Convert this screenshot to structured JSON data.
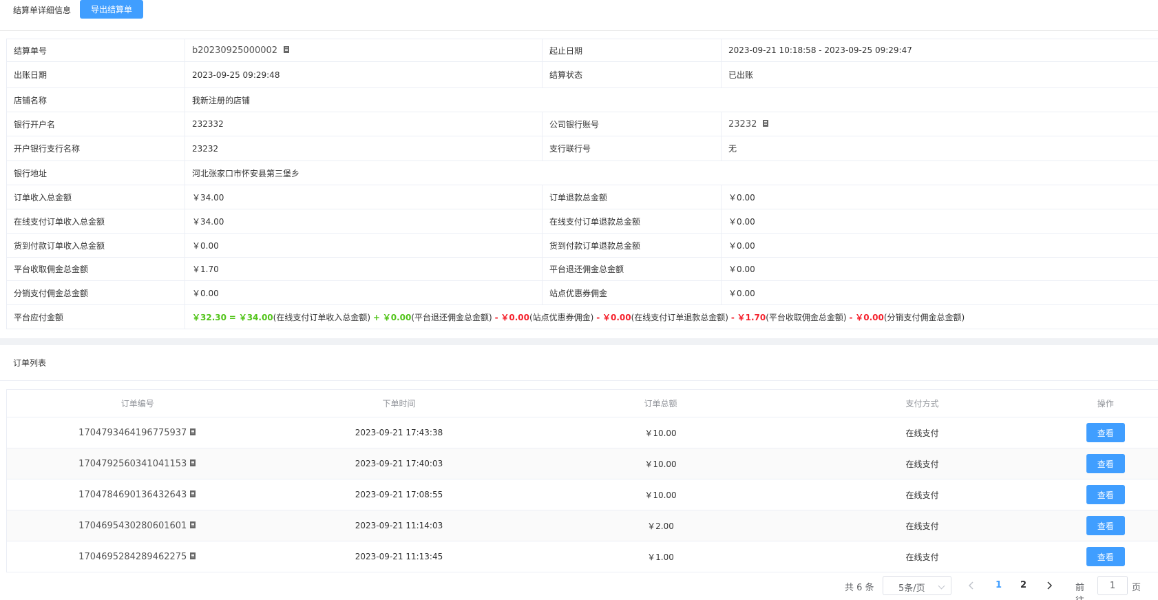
{
  "header": {
    "title": "结算单详细信息",
    "export_label": "导出结算单"
  },
  "info": {
    "bill_no_label": "结算单号",
    "bill_no": "b20230925000002",
    "period_label": "起止日期",
    "period": "2023-09-21 10:18:58 - 2023-09-25 09:29:47",
    "bill_date_label": "出账日期",
    "bill_date": "2023-09-25 09:29:48",
    "status_label": "结算状态",
    "status": "已出账",
    "shop_label": "店铺名称",
    "shop": "我新注册的店铺",
    "bank_account_name_label": "银行开户名",
    "bank_account_name": "232332",
    "company_account_label": "公司银行账号",
    "company_account": "23232",
    "branch_label": "开户银行支行名称",
    "branch": "23232",
    "branch_code_label": "支行联行号",
    "branch_code": "无",
    "bank_address_label": "银行地址",
    "bank_address": "河北张家口市怀安县第三堡乡",
    "order_income_label": "订单收入总金额",
    "order_income": "￥34.00",
    "order_refund_label": "订单退款总金额",
    "order_refund": "￥0.00",
    "online_income_label": "在线支付订单收入总金额",
    "online_income": "￥34.00",
    "online_refund_label": "在线支付订单退款总金额",
    "online_refund": "￥0.00",
    "cod_income_label": "货到付款订单收入总金额",
    "cod_income": "￥0.00",
    "cod_refund_label": "货到付款订单退款总金额",
    "cod_refund": "￥0.00",
    "commission_label": "平台收取佣金总金额",
    "commission": "￥1.70",
    "commission_return_label": "平台退还佣金总金额",
    "commission_return": "￥0.00",
    "distribution_label": "分销支付佣金总金额",
    "distribution": "￥0.00",
    "coupon_label": "站点优惠券佣金",
    "coupon": "￥0.00",
    "payable_label": "平台应付金额",
    "formula": {
      "result": "￥32.30",
      "eq": "=",
      "v1": "￥34.00",
      "t1": "(在线支付订单收入总金额)",
      "op1": "+",
      "v2": "￥0.00",
      "t2": "(平台退还佣金总金额)",
      "op2": "-",
      "v3": "￥0.00",
      "t3": "(站点优惠券佣金)",
      "op3": "-",
      "v4": "￥0.00",
      "t4": "(在线支付订单退款总金额)",
      "op4": "-",
      "v5": "￥1.70",
      "t5": "(平台收取佣金总金额)",
      "op5": "-",
      "v6": "￥0.00",
      "t6": "(分销支付佣金总金额)"
    }
  },
  "orders": {
    "title": "订单列表",
    "columns": [
      "订单编号",
      "下单时间",
      "订单总额",
      "支付方式",
      "操作"
    ],
    "view_label": "查看",
    "rows": [
      {
        "id": "1704793464196775937",
        "time": "2023-09-21 17:43:38",
        "amount": "￥10.00",
        "pay": "在线支付"
      },
      {
        "id": "1704792560341041153",
        "time": "2023-09-21 17:40:03",
        "amount": "￥10.00",
        "pay": "在线支付"
      },
      {
        "id": "1704784690136432643",
        "time": "2023-09-21 17:08:55",
        "amount": "￥10.00",
        "pay": "在线支付"
      },
      {
        "id": "1704695430280601601",
        "time": "2023-09-21 11:14:03",
        "amount": "￥2.00",
        "pay": "在线支付"
      },
      {
        "id": "1704695284289462275",
        "time": "2023-09-21 11:13:45",
        "amount": "￥1.00",
        "pay": "在线支付"
      }
    ]
  },
  "pager": {
    "total": "共 6 条",
    "page_size": "5条/页",
    "prev_icon": "chevron-left-icon",
    "next_icon": "chevron-right-icon",
    "pages": [
      "1",
      "2"
    ],
    "goto_label": "前往",
    "goto_value": "1",
    "page_unit": "页"
  },
  "colors": {
    "primary": "#409eff",
    "positive": "#52c41a",
    "negative": "#f5222d"
  }
}
